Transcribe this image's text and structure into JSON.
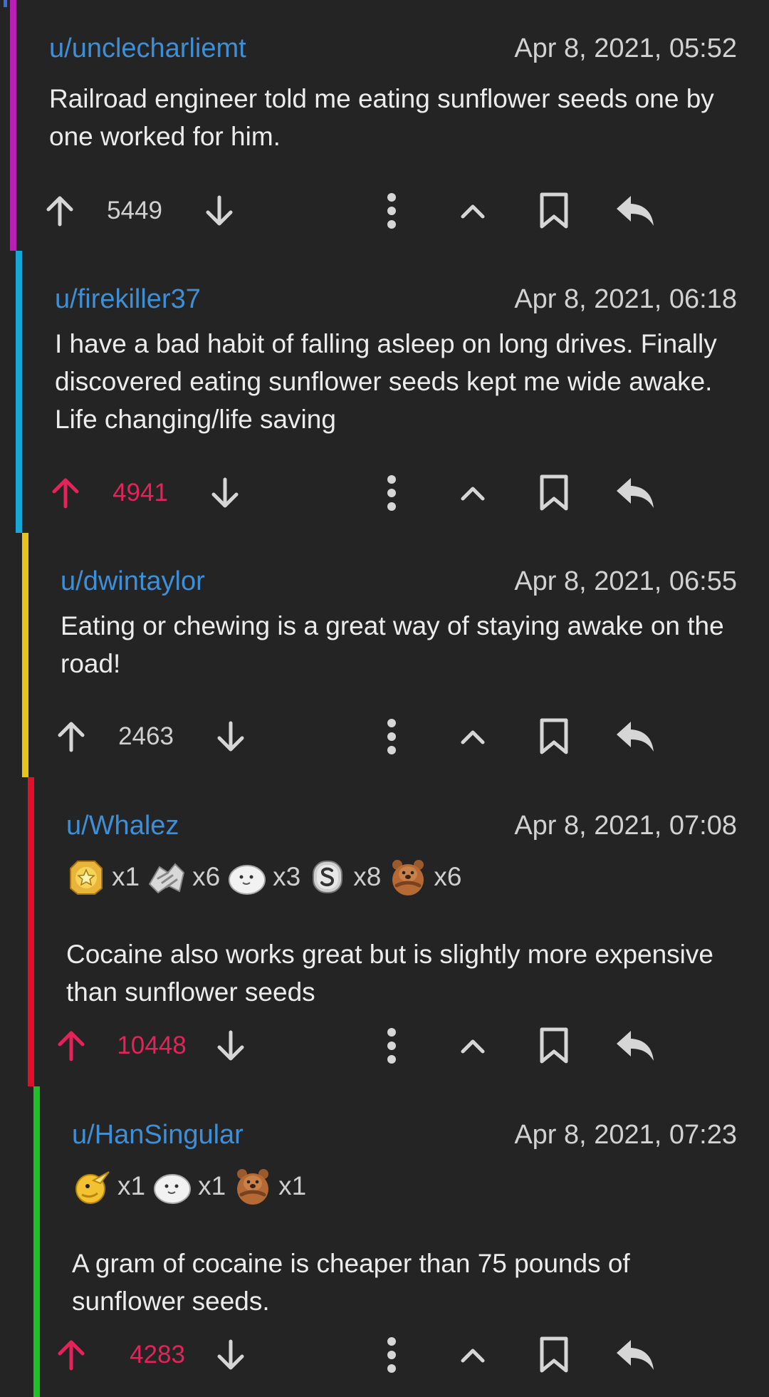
{
  "colors": {
    "background": "#242424",
    "username": "#3f8fd6",
    "upvoted": "#e4235a",
    "icon": "#d6d6d6"
  },
  "comments": [
    {
      "author": "u/unclecharliemt",
      "time": "Apr 8, 2021, 05:52",
      "body": "Railroad engineer told me  eating sunflower seeds one by one worked for him.",
      "score": "5449",
      "upvoted": false,
      "thread_color": "#b81fb4",
      "awards": []
    },
    {
      "author": "u/firekiller37",
      "time": "Apr 8, 2021, 06:18",
      "body": "I have a bad habit of falling asleep on long drives. Finally discovered eating sunflower seeds kept me wide awake. Life changing/life saving",
      "score": "4941",
      "upvoted": true,
      "thread_color": "#17a6d6",
      "awards": []
    },
    {
      "author": "u/dwintaylor",
      "time": "Apr 8, 2021, 06:55",
      "body": "Eating or chewing is a great way of staying awake on the road!",
      "score": "2463",
      "upvoted": false,
      "thread_color": "#e8c31a",
      "awards": []
    },
    {
      "author": "u/Whalez",
      "time": "Apr 8, 2021, 07:08",
      "body": "Cocaine also works great but is slightly more expensive than sunflower seeds",
      "score": "10448",
      "upvoted": true,
      "thread_color": "#e0102a",
      "awards": [
        {
          "icon": "gold-star-award-icon",
          "count": "x1"
        },
        {
          "icon": "handshake-award-icon",
          "count": "x6"
        },
        {
          "icon": "seal-award-icon",
          "count": "x3"
        },
        {
          "icon": "silver-coin-award-icon",
          "count": "x8"
        },
        {
          "icon": "bear-award-icon",
          "count": "x6"
        }
      ]
    },
    {
      "author": "u/HanSingular",
      "time": "Apr 8, 2021, 07:23",
      "body": "A gram of cocaine is cheaper than 75 pounds of sunflower seeds.",
      "score": "4283",
      "upvoted": true,
      "thread_color": "#1fbf2a",
      "awards": [
        {
          "icon": "snipe-bird-award-icon",
          "count": "x1"
        },
        {
          "icon": "seal-award-icon",
          "count": "x1"
        },
        {
          "icon": "bear-award-icon",
          "count": "x1"
        }
      ]
    }
  ]
}
